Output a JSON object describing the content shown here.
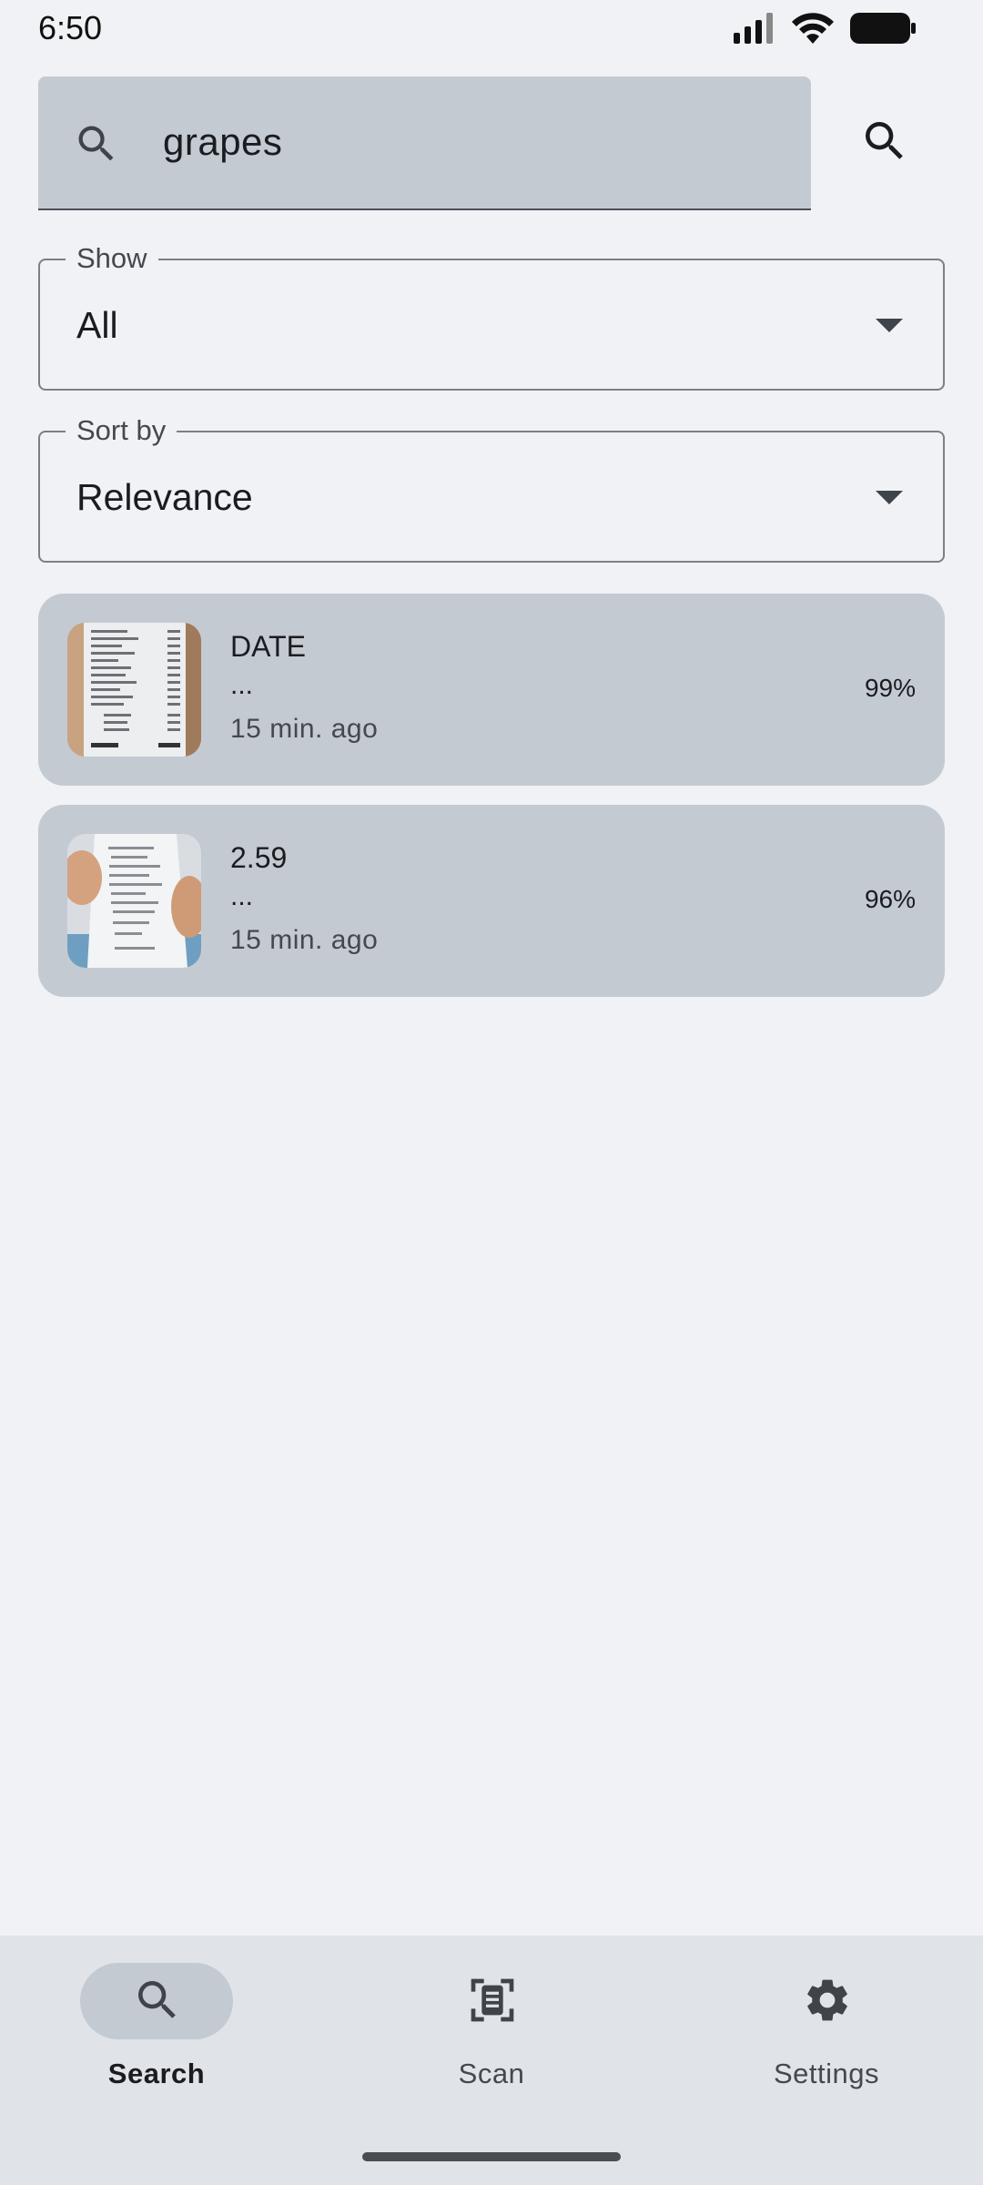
{
  "status_bar": {
    "time": "6:50",
    "icons": [
      "signal-icon",
      "wifi-icon",
      "battery-icon"
    ]
  },
  "search": {
    "query": "grapes",
    "lead_icon": "search-icon",
    "action_icon": "search-icon"
  },
  "filters": {
    "show": {
      "label": "Show",
      "value": "All"
    },
    "sort": {
      "label": "Sort by",
      "value": "Relevance"
    }
  },
  "results": [
    {
      "title": "DATE",
      "snippet": "...",
      "time": "15 min. ago",
      "score": "99%",
      "thumbnail": "receipt-photo"
    },
    {
      "title": "2.59",
      "snippet": "...",
      "time": "15 min. ago",
      "score": "96%",
      "thumbnail": "receipt-in-hand-photo"
    }
  ],
  "nav": {
    "items": [
      {
        "label": "Search",
        "icon": "search-icon",
        "active": true
      },
      {
        "label": "Scan",
        "icon": "document-scanner-icon",
        "active": false
      },
      {
        "label": "Settings",
        "icon": "gear-icon",
        "active": false
      }
    ]
  },
  "colors": {
    "background": "#f0f2f5",
    "surface": "#c4cad2",
    "nav_background": "#e0e3e8",
    "text": "#1b1c1f",
    "text_secondary": "#444850",
    "outline": "#7a7f88"
  }
}
